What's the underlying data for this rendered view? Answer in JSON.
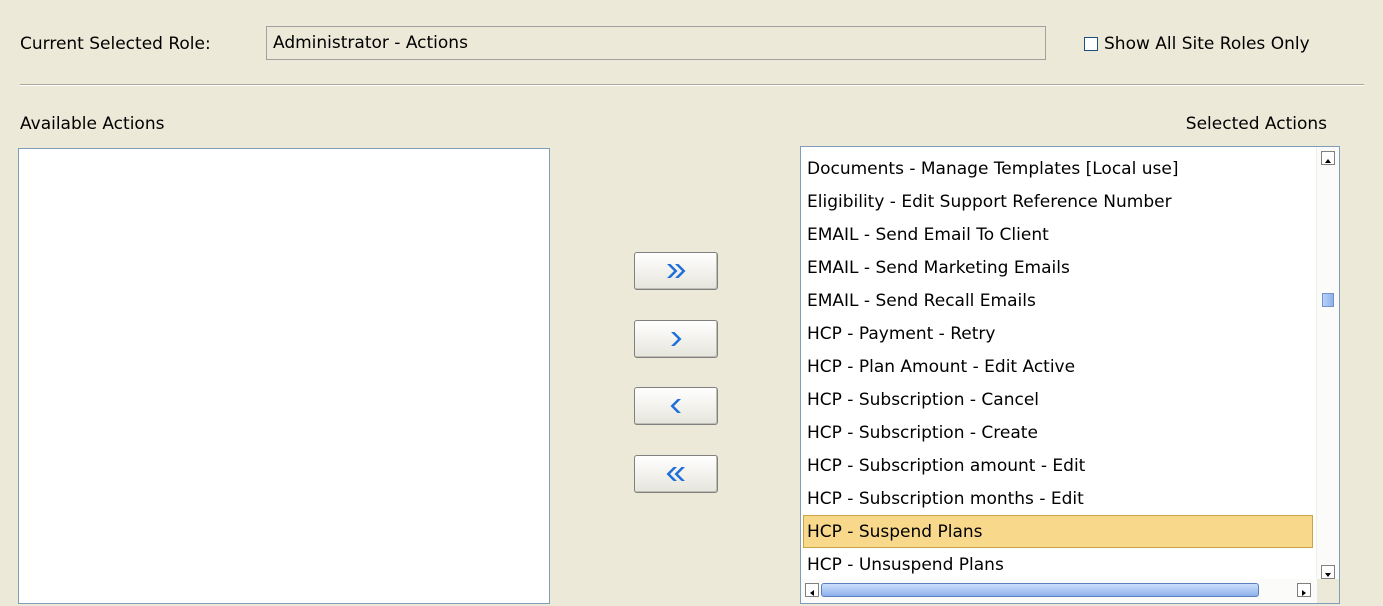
{
  "role": {
    "label": "Current Selected Role:",
    "value": "Administrator - Actions"
  },
  "show_all": {
    "label": "Show All Site Roles Only",
    "checked": false
  },
  "available": {
    "label": "Available Actions",
    "items": []
  },
  "selected": {
    "label": "Selected Actions",
    "items": [
      "Documents - Manage Templates [Local use]",
      "Eligibility - Edit Support Reference Number",
      "EMAIL - Send Email To Client",
      "EMAIL - Send Marketing Emails",
      "EMAIL - Send Recall Emails",
      "HCP - Payment - Retry",
      "HCP - Plan Amount - Edit Active",
      "HCP - Subscription - Cancel",
      "HCP - Subscription - Create",
      "HCP - Subscription amount - Edit",
      "HCP - Subscription months - Edit",
      "HCP - Suspend Plans",
      "HCP - Unsuspend Plans"
    ],
    "highlighted": "HCP - Suspend Plans"
  },
  "buttons": [
    {
      "name": "move-all-right-button",
      "icon": "double-chevron-right-icon"
    },
    {
      "name": "move-right-button",
      "icon": "chevron-right-icon"
    },
    {
      "name": "move-left-button",
      "icon": "chevron-left-icon"
    },
    {
      "name": "move-all-left-button",
      "icon": "double-chevron-left-icon"
    }
  ],
  "colors": {
    "panel": "#ece9d8",
    "highlight": "#f8d98c",
    "arrow": "#1e6fd9"
  }
}
